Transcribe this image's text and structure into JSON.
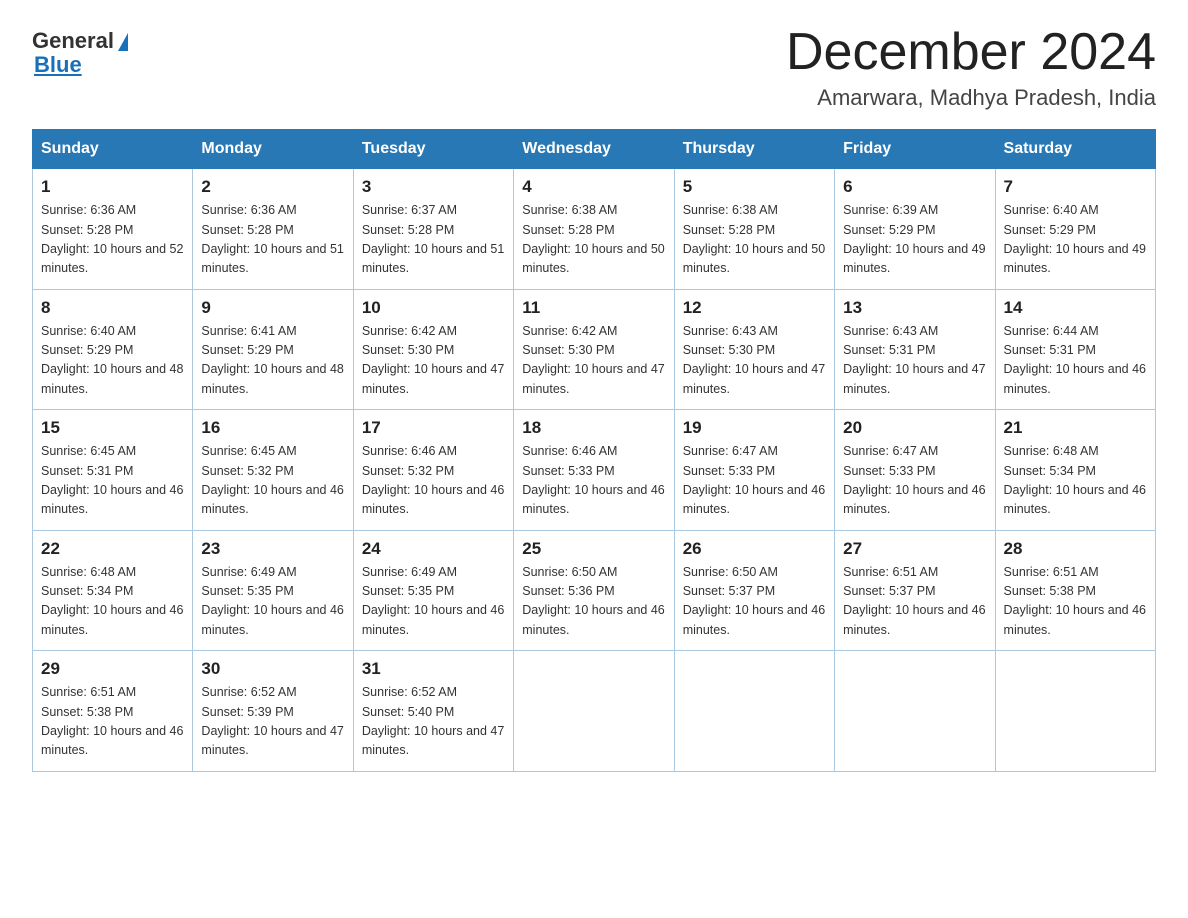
{
  "header": {
    "logo_general": "General",
    "logo_blue": "Blue",
    "month_title": "December 2024",
    "location": "Amarwara, Madhya Pradesh, India"
  },
  "weekdays": [
    "Sunday",
    "Monday",
    "Tuesday",
    "Wednesday",
    "Thursday",
    "Friday",
    "Saturday"
  ],
  "weeks": [
    [
      {
        "day": "1",
        "sunrise": "6:36 AM",
        "sunset": "5:28 PM",
        "daylight": "10 hours and 52 minutes."
      },
      {
        "day": "2",
        "sunrise": "6:36 AM",
        "sunset": "5:28 PM",
        "daylight": "10 hours and 51 minutes."
      },
      {
        "day": "3",
        "sunrise": "6:37 AM",
        "sunset": "5:28 PM",
        "daylight": "10 hours and 51 minutes."
      },
      {
        "day": "4",
        "sunrise": "6:38 AM",
        "sunset": "5:28 PM",
        "daylight": "10 hours and 50 minutes."
      },
      {
        "day": "5",
        "sunrise": "6:38 AM",
        "sunset": "5:28 PM",
        "daylight": "10 hours and 50 minutes."
      },
      {
        "day": "6",
        "sunrise": "6:39 AM",
        "sunset": "5:29 PM",
        "daylight": "10 hours and 49 minutes."
      },
      {
        "day": "7",
        "sunrise": "6:40 AM",
        "sunset": "5:29 PM",
        "daylight": "10 hours and 49 minutes."
      }
    ],
    [
      {
        "day": "8",
        "sunrise": "6:40 AM",
        "sunset": "5:29 PM",
        "daylight": "10 hours and 48 minutes."
      },
      {
        "day": "9",
        "sunrise": "6:41 AM",
        "sunset": "5:29 PM",
        "daylight": "10 hours and 48 minutes."
      },
      {
        "day": "10",
        "sunrise": "6:42 AM",
        "sunset": "5:30 PM",
        "daylight": "10 hours and 47 minutes."
      },
      {
        "day": "11",
        "sunrise": "6:42 AM",
        "sunset": "5:30 PM",
        "daylight": "10 hours and 47 minutes."
      },
      {
        "day": "12",
        "sunrise": "6:43 AM",
        "sunset": "5:30 PM",
        "daylight": "10 hours and 47 minutes."
      },
      {
        "day": "13",
        "sunrise": "6:43 AM",
        "sunset": "5:31 PM",
        "daylight": "10 hours and 47 minutes."
      },
      {
        "day": "14",
        "sunrise": "6:44 AM",
        "sunset": "5:31 PM",
        "daylight": "10 hours and 46 minutes."
      }
    ],
    [
      {
        "day": "15",
        "sunrise": "6:45 AM",
        "sunset": "5:31 PM",
        "daylight": "10 hours and 46 minutes."
      },
      {
        "day": "16",
        "sunrise": "6:45 AM",
        "sunset": "5:32 PM",
        "daylight": "10 hours and 46 minutes."
      },
      {
        "day": "17",
        "sunrise": "6:46 AM",
        "sunset": "5:32 PM",
        "daylight": "10 hours and 46 minutes."
      },
      {
        "day": "18",
        "sunrise": "6:46 AM",
        "sunset": "5:33 PM",
        "daylight": "10 hours and 46 minutes."
      },
      {
        "day": "19",
        "sunrise": "6:47 AM",
        "sunset": "5:33 PM",
        "daylight": "10 hours and 46 minutes."
      },
      {
        "day": "20",
        "sunrise": "6:47 AM",
        "sunset": "5:33 PM",
        "daylight": "10 hours and 46 minutes."
      },
      {
        "day": "21",
        "sunrise": "6:48 AM",
        "sunset": "5:34 PM",
        "daylight": "10 hours and 46 minutes."
      }
    ],
    [
      {
        "day": "22",
        "sunrise": "6:48 AM",
        "sunset": "5:34 PM",
        "daylight": "10 hours and 46 minutes."
      },
      {
        "day": "23",
        "sunrise": "6:49 AM",
        "sunset": "5:35 PM",
        "daylight": "10 hours and 46 minutes."
      },
      {
        "day": "24",
        "sunrise": "6:49 AM",
        "sunset": "5:35 PM",
        "daylight": "10 hours and 46 minutes."
      },
      {
        "day": "25",
        "sunrise": "6:50 AM",
        "sunset": "5:36 PM",
        "daylight": "10 hours and 46 minutes."
      },
      {
        "day": "26",
        "sunrise": "6:50 AM",
        "sunset": "5:37 PM",
        "daylight": "10 hours and 46 minutes."
      },
      {
        "day": "27",
        "sunrise": "6:51 AM",
        "sunset": "5:37 PM",
        "daylight": "10 hours and 46 minutes."
      },
      {
        "day": "28",
        "sunrise": "6:51 AM",
        "sunset": "5:38 PM",
        "daylight": "10 hours and 46 minutes."
      }
    ],
    [
      {
        "day": "29",
        "sunrise": "6:51 AM",
        "sunset": "5:38 PM",
        "daylight": "10 hours and 46 minutes."
      },
      {
        "day": "30",
        "sunrise": "6:52 AM",
        "sunset": "5:39 PM",
        "daylight": "10 hours and 47 minutes."
      },
      {
        "day": "31",
        "sunrise": "6:52 AM",
        "sunset": "5:40 PM",
        "daylight": "10 hours and 47 minutes."
      },
      null,
      null,
      null,
      null
    ]
  ]
}
